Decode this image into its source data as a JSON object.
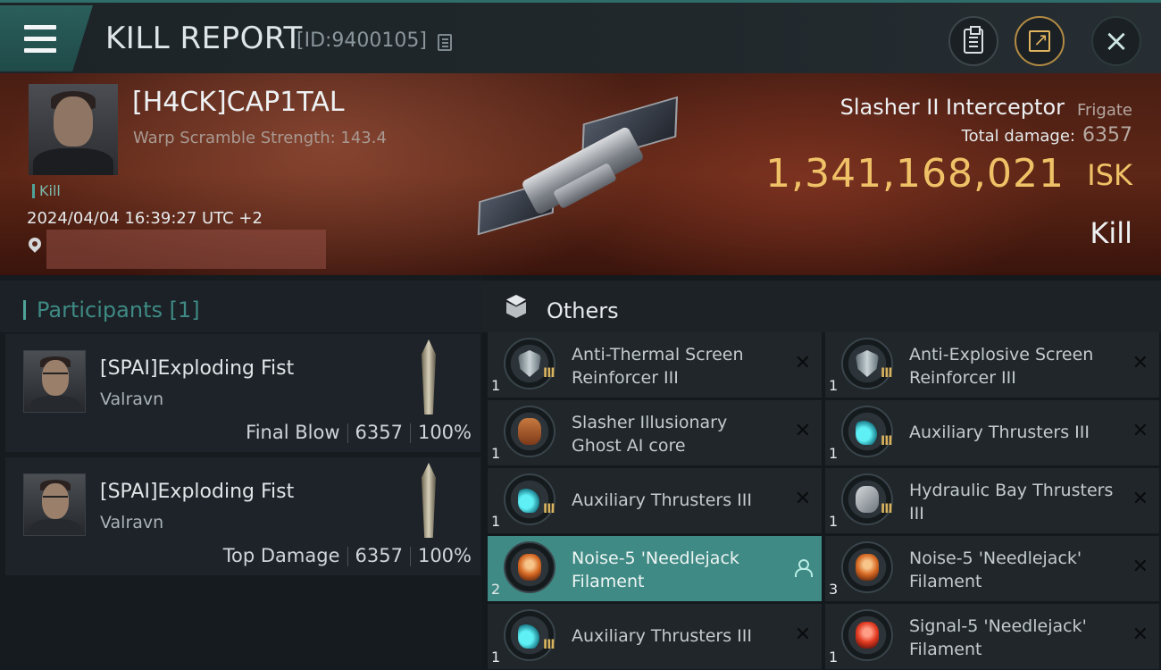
{
  "header": {
    "title": "KILL REPORT",
    "report_id": "[ID:9400105]"
  },
  "victim": {
    "name": "[H4CK]CAP1TAL",
    "warp_scramble": "Warp Scramble Strength: 143.4",
    "result_tag": "Kill",
    "datetime": "2024/04/04 16:39:27 UTC +2",
    "ship_name": "Slasher II Interceptor",
    "ship_class": "Frigate",
    "total_damage_label": "Total damage:",
    "total_damage": "6357",
    "isk_value": "1,341,168,021",
    "isk_label": "ISK",
    "result": "Kill"
  },
  "participants": {
    "title": "Participants [1]",
    "list": [
      {
        "name": "[SPAI]Exploding Fist",
        "ship": "Valravn",
        "role": "Final Blow",
        "damage": "6357",
        "percent": "100%"
      },
      {
        "name": "[SPAI]Exploding Fist",
        "ship": "Valravn",
        "role": "Top Damage",
        "damage": "6357",
        "percent": "100%"
      }
    ]
  },
  "others": {
    "title": "Others",
    "items": [
      {
        "name": "Anti-Thermal Screen Reinforcer III",
        "qty": "1",
        "icon": "shield-module-icon"
      },
      {
        "name": "Anti-Explosive Screen Reinforcer III",
        "qty": "1",
        "icon": "shield-module-icon"
      },
      {
        "name": "Slasher Illusionary Ghost AI core",
        "qty": "1",
        "icon": "ai-core-icon"
      },
      {
        "name": "Auxiliary Thrusters III",
        "qty": "1",
        "icon": "thruster-icon"
      },
      {
        "name": "Auxiliary Thrusters III",
        "qty": "1",
        "icon": "thruster-icon"
      },
      {
        "name": "Hydraulic Bay Thrusters III",
        "qty": "1",
        "icon": "hydraulic-icon"
      },
      {
        "name": "Noise-5 'Needlejack Filament",
        "qty": "2",
        "icon": "filament-icon",
        "selected": true
      },
      {
        "name": "Noise-5 'Needlejack' Filament",
        "qty": "3",
        "icon": "filament-icon"
      },
      {
        "name": "Auxiliary Thrusters III",
        "qty": "1",
        "icon": "thruster-icon"
      },
      {
        "name": "Signal-5 'Needlejack' Filament",
        "qty": "1",
        "icon": "filament-icon"
      }
    ]
  },
  "colors": {
    "accent_teal": "#3f8a84",
    "isk_gold": "#f0c267"
  }
}
